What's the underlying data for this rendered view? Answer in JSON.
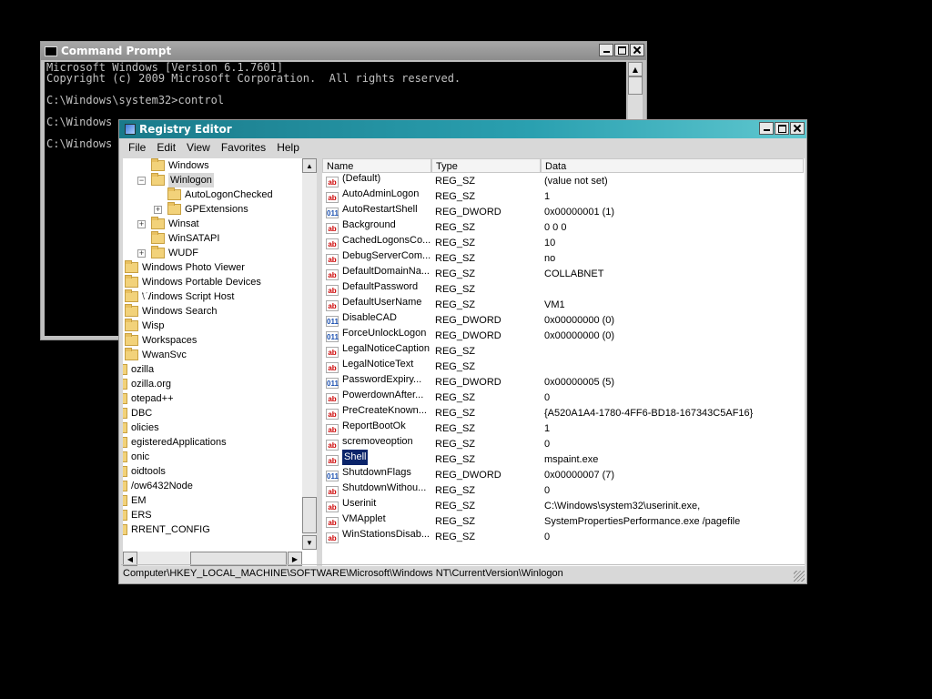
{
  "cmd": {
    "title": "Command Prompt",
    "lines": [
      "Microsoft Windows [Version 6.1.7601]",
      "Copyright (c) 2009 Microsoft Corporation.  All rights reserved.",
      "",
      "C:\\Windows\\system32>control",
      "",
      "C:\\Windows",
      "",
      "C:\\Windows"
    ]
  },
  "regedit": {
    "title": "Registry Editor",
    "menu": [
      "File",
      "Edit",
      "View",
      "Favorites",
      "Help"
    ],
    "tree": [
      {
        "label": "Windows",
        "level": 2,
        "exp": ""
      },
      {
        "label": "Winlogon",
        "level": 2,
        "exp": "−",
        "selected": true
      },
      {
        "label": "AutoLogonChecked",
        "level": 3,
        "exp": ""
      },
      {
        "label": "GPExtensions",
        "level": 3,
        "exp": "+"
      },
      {
        "label": "Winsat",
        "level": 2,
        "exp": "+"
      },
      {
        "label": "WinSATAPI",
        "level": 2,
        "exp": ""
      },
      {
        "label": "WUDF",
        "level": 2,
        "exp": "+"
      },
      {
        "label": "Windows Photo Viewer",
        "level": 1,
        "exp": ""
      },
      {
        "label": "Windows Portable Devices",
        "level": 1,
        "exp": ""
      },
      {
        "label": "Windows Script Host",
        "level": 1,
        "exp": ""
      },
      {
        "label": "Windows Search",
        "level": 1,
        "exp": ""
      },
      {
        "label": "Wisp",
        "level": 1,
        "exp": ""
      },
      {
        "label": "Workspaces",
        "level": 1,
        "exp": ""
      },
      {
        "label": "WwanSvc",
        "level": 1,
        "exp": ""
      },
      {
        "label": "ozilla",
        "level": 0,
        "exp": ""
      },
      {
        "label": "ozilla.org",
        "level": 0,
        "exp": ""
      },
      {
        "label": "otepad++",
        "level": 0,
        "exp": ""
      },
      {
        "label": "DBC",
        "level": 0,
        "exp": ""
      },
      {
        "label": "olicies",
        "level": 0,
        "exp": ""
      },
      {
        "label": "egisteredApplications",
        "level": 0,
        "exp": ""
      },
      {
        "label": "onic",
        "level": 0,
        "exp": ""
      },
      {
        "label": "oidtools",
        "level": 0,
        "exp": ""
      },
      {
        "label": "/ow6432Node",
        "level": 0,
        "exp": ""
      },
      {
        "label": "EM",
        "level": 0,
        "exp": ""
      },
      {
        "label": "ERS",
        "level": 0,
        "exp": ""
      },
      {
        "label": "RRENT_CONFIG",
        "level": 0,
        "exp": ""
      }
    ],
    "columns": [
      "Name",
      "Type",
      "Data"
    ],
    "values": [
      {
        "icon": "ab",
        "name": "(Default)",
        "type": "REG_SZ",
        "data": "(value not set)"
      },
      {
        "icon": "ab",
        "name": "AutoAdminLogon",
        "type": "REG_SZ",
        "data": "1"
      },
      {
        "icon": "dw",
        "name": "AutoRestartShell",
        "type": "REG_DWORD",
        "data": "0x00000001 (1)"
      },
      {
        "icon": "ab",
        "name": "Background",
        "type": "REG_SZ",
        "data": "0 0 0"
      },
      {
        "icon": "ab",
        "name": "CachedLogonsCo...",
        "type": "REG_SZ",
        "data": "10"
      },
      {
        "icon": "ab",
        "name": "DebugServerCom...",
        "type": "REG_SZ",
        "data": "no"
      },
      {
        "icon": "ab",
        "name": "DefaultDomainNa...",
        "type": "REG_SZ",
        "data": "COLLABNET"
      },
      {
        "icon": "ab",
        "name": "DefaultPassword",
        "type": "REG_SZ",
        "data": ""
      },
      {
        "icon": "ab",
        "name": "DefaultUserName",
        "type": "REG_SZ",
        "data": "VM1"
      },
      {
        "icon": "dw",
        "name": "DisableCAD",
        "type": "REG_DWORD",
        "data": "0x00000000 (0)"
      },
      {
        "icon": "dw",
        "name": "ForceUnlockLogon",
        "type": "REG_DWORD",
        "data": "0x00000000 (0)"
      },
      {
        "icon": "ab",
        "name": "LegalNoticeCaption",
        "type": "REG_SZ",
        "data": ""
      },
      {
        "icon": "ab",
        "name": "LegalNoticeText",
        "type": "REG_SZ",
        "data": ""
      },
      {
        "icon": "dw",
        "name": "PasswordExpiry...",
        "type": "REG_DWORD",
        "data": "0x00000005 (5)"
      },
      {
        "icon": "ab",
        "name": "PowerdownAfter...",
        "type": "REG_SZ",
        "data": "0"
      },
      {
        "icon": "ab",
        "name": "PreCreateKnown...",
        "type": "REG_SZ",
        "data": "{A520A1A4-1780-4FF6-BD18-167343C5AF16}"
      },
      {
        "icon": "ab",
        "name": "ReportBootOk",
        "type": "REG_SZ",
        "data": "1"
      },
      {
        "icon": "ab",
        "name": "scremoveoption",
        "type": "REG_SZ",
        "data": "0"
      },
      {
        "icon": "ab",
        "name": "Shell",
        "type": "REG_SZ",
        "data": "mspaint.exe",
        "selected": true
      },
      {
        "icon": "dw",
        "name": "ShutdownFlags",
        "type": "REG_DWORD",
        "data": "0x00000007 (7)"
      },
      {
        "icon": "ab",
        "name": "ShutdownWithou...",
        "type": "REG_SZ",
        "data": "0"
      },
      {
        "icon": "ab",
        "name": "Userinit",
        "type": "REG_SZ",
        "data": "C:\\Windows\\system32\\userinit.exe,"
      },
      {
        "icon": "ab",
        "name": "VMApplet",
        "type": "REG_SZ",
        "data": "SystemPropertiesPerformance.exe /pagefile"
      },
      {
        "icon": "ab",
        "name": "WinStationsDisab...",
        "type": "REG_SZ",
        "data": "0"
      }
    ],
    "status": "Computer\\HKEY_LOCAL_MACHINE\\SOFTWARE\\Microsoft\\Windows NT\\CurrentVersion\\Winlogon"
  },
  "colors": {
    "regedit_title": "#1a7a8a",
    "cmd_title": "#a0a0a0",
    "selection": "#0a246a",
    "desktop": "#000000"
  }
}
